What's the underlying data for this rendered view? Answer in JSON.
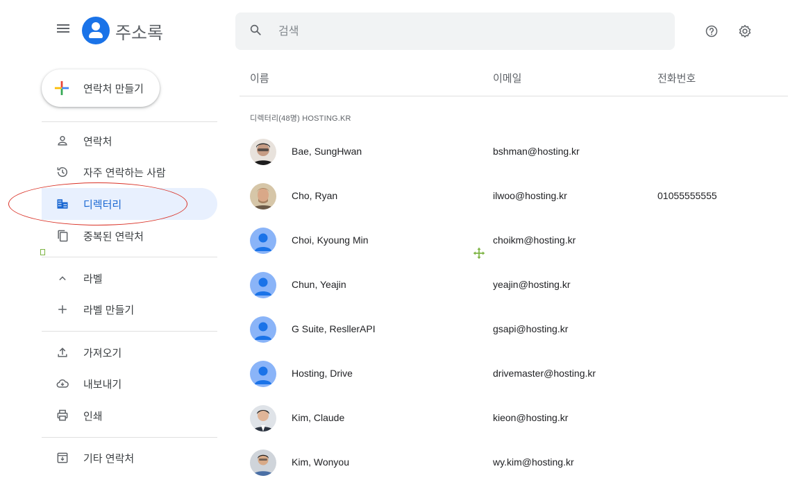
{
  "header": {
    "title": "주소록",
    "search": {
      "placeholder": "검색",
      "value": ""
    },
    "icons": [
      "hamburger-menu-icon",
      "contacts-logo-icon",
      "search-icon",
      "help-icon",
      "settings-gear-icon"
    ]
  },
  "sidebar": {
    "create_label": "연락처 만들기",
    "items": [
      {
        "label": "연락처",
        "icon": "person-icon"
      },
      {
        "label": "자주 연락하는 사람",
        "icon": "history-icon"
      },
      {
        "label": "디렉터리",
        "icon": "domain-icon",
        "active": true
      },
      {
        "label": "중복된 연락처",
        "icon": "copy-icon"
      },
      {
        "label": "라벨",
        "icon": "chevron-up-icon"
      },
      {
        "label": "라벨 만들기",
        "icon": "add-icon"
      },
      {
        "label": "가져오기",
        "icon": "upload-icon"
      },
      {
        "label": "내보내기",
        "icon": "cloud-download-icon"
      },
      {
        "label": "인쇄",
        "icon": "print-icon"
      },
      {
        "label": "기타 연락처",
        "icon": "archive-icon"
      }
    ]
  },
  "table": {
    "columns": {
      "name": "이름",
      "email": "이메일",
      "phone": "전화번호"
    },
    "section_label": "디렉터리(48명) HOSTING.KR",
    "rows": [
      {
        "name": "Bae, SungHwan",
        "email": "bshman@hosting.kr",
        "phone": "",
        "avatar": "photo"
      },
      {
        "name": "Cho, Ryan",
        "email": "ilwoo@hosting.kr",
        "phone": "01055555555",
        "avatar": "photo"
      },
      {
        "name": "Choi, Kyoung Min",
        "email": "choikm@hosting.kr",
        "phone": "",
        "avatar": "default"
      },
      {
        "name": "Chun, Yeajin",
        "email": "yeajin@hosting.kr",
        "phone": "",
        "avatar": "default"
      },
      {
        "name": "G Suite, ResllerAPI",
        "email": "gsapi@hosting.kr",
        "phone": "",
        "avatar": "default"
      },
      {
        "name": "Hosting, Drive",
        "email": "drivemaster@hosting.kr",
        "phone": "",
        "avatar": "default"
      },
      {
        "name": "Kim, Claude",
        "email": "kieon@hosting.kr",
        "phone": "",
        "avatar": "photo"
      },
      {
        "name": "Kim, Wonyou",
        "email": "wy.kim@hosting.kr",
        "phone": "",
        "avatar": "photo"
      }
    ]
  },
  "colors": {
    "accent": "#1a73e8",
    "active_bg": "#e8f0fe",
    "annotation": "#d93025",
    "avatar_default": "#8ab4f8"
  }
}
